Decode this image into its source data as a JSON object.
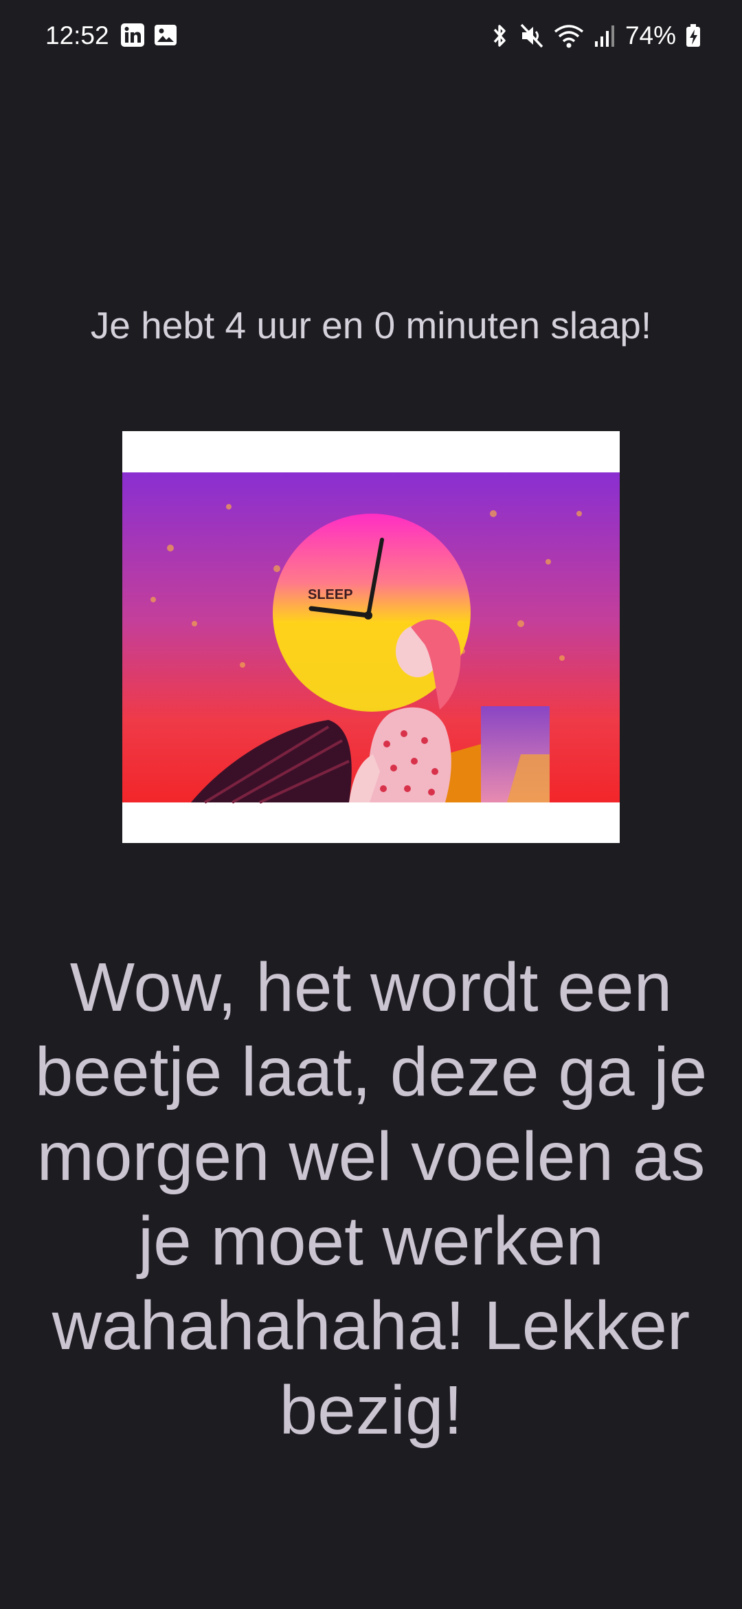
{
  "status_bar": {
    "time": "12:52",
    "left_icons": [
      "linkedin-icon",
      "image-icon"
    ],
    "right_icons": [
      "bluetooth-icon",
      "mute-icon",
      "wifi-icon",
      "signal-icon",
      "battery-charging-icon"
    ],
    "battery": "74%"
  },
  "sleep_summary": "Je hebt 4 uur en 0 minuten slaap!",
  "illustration": {
    "icon": "clock-woman-illustration",
    "clock_label": "SLEEP"
  },
  "message": "Wow, het wordt een beetje laat, deze ga je morgen wel voelen as je moet werken wahahahaha! Lekker bezig!"
}
